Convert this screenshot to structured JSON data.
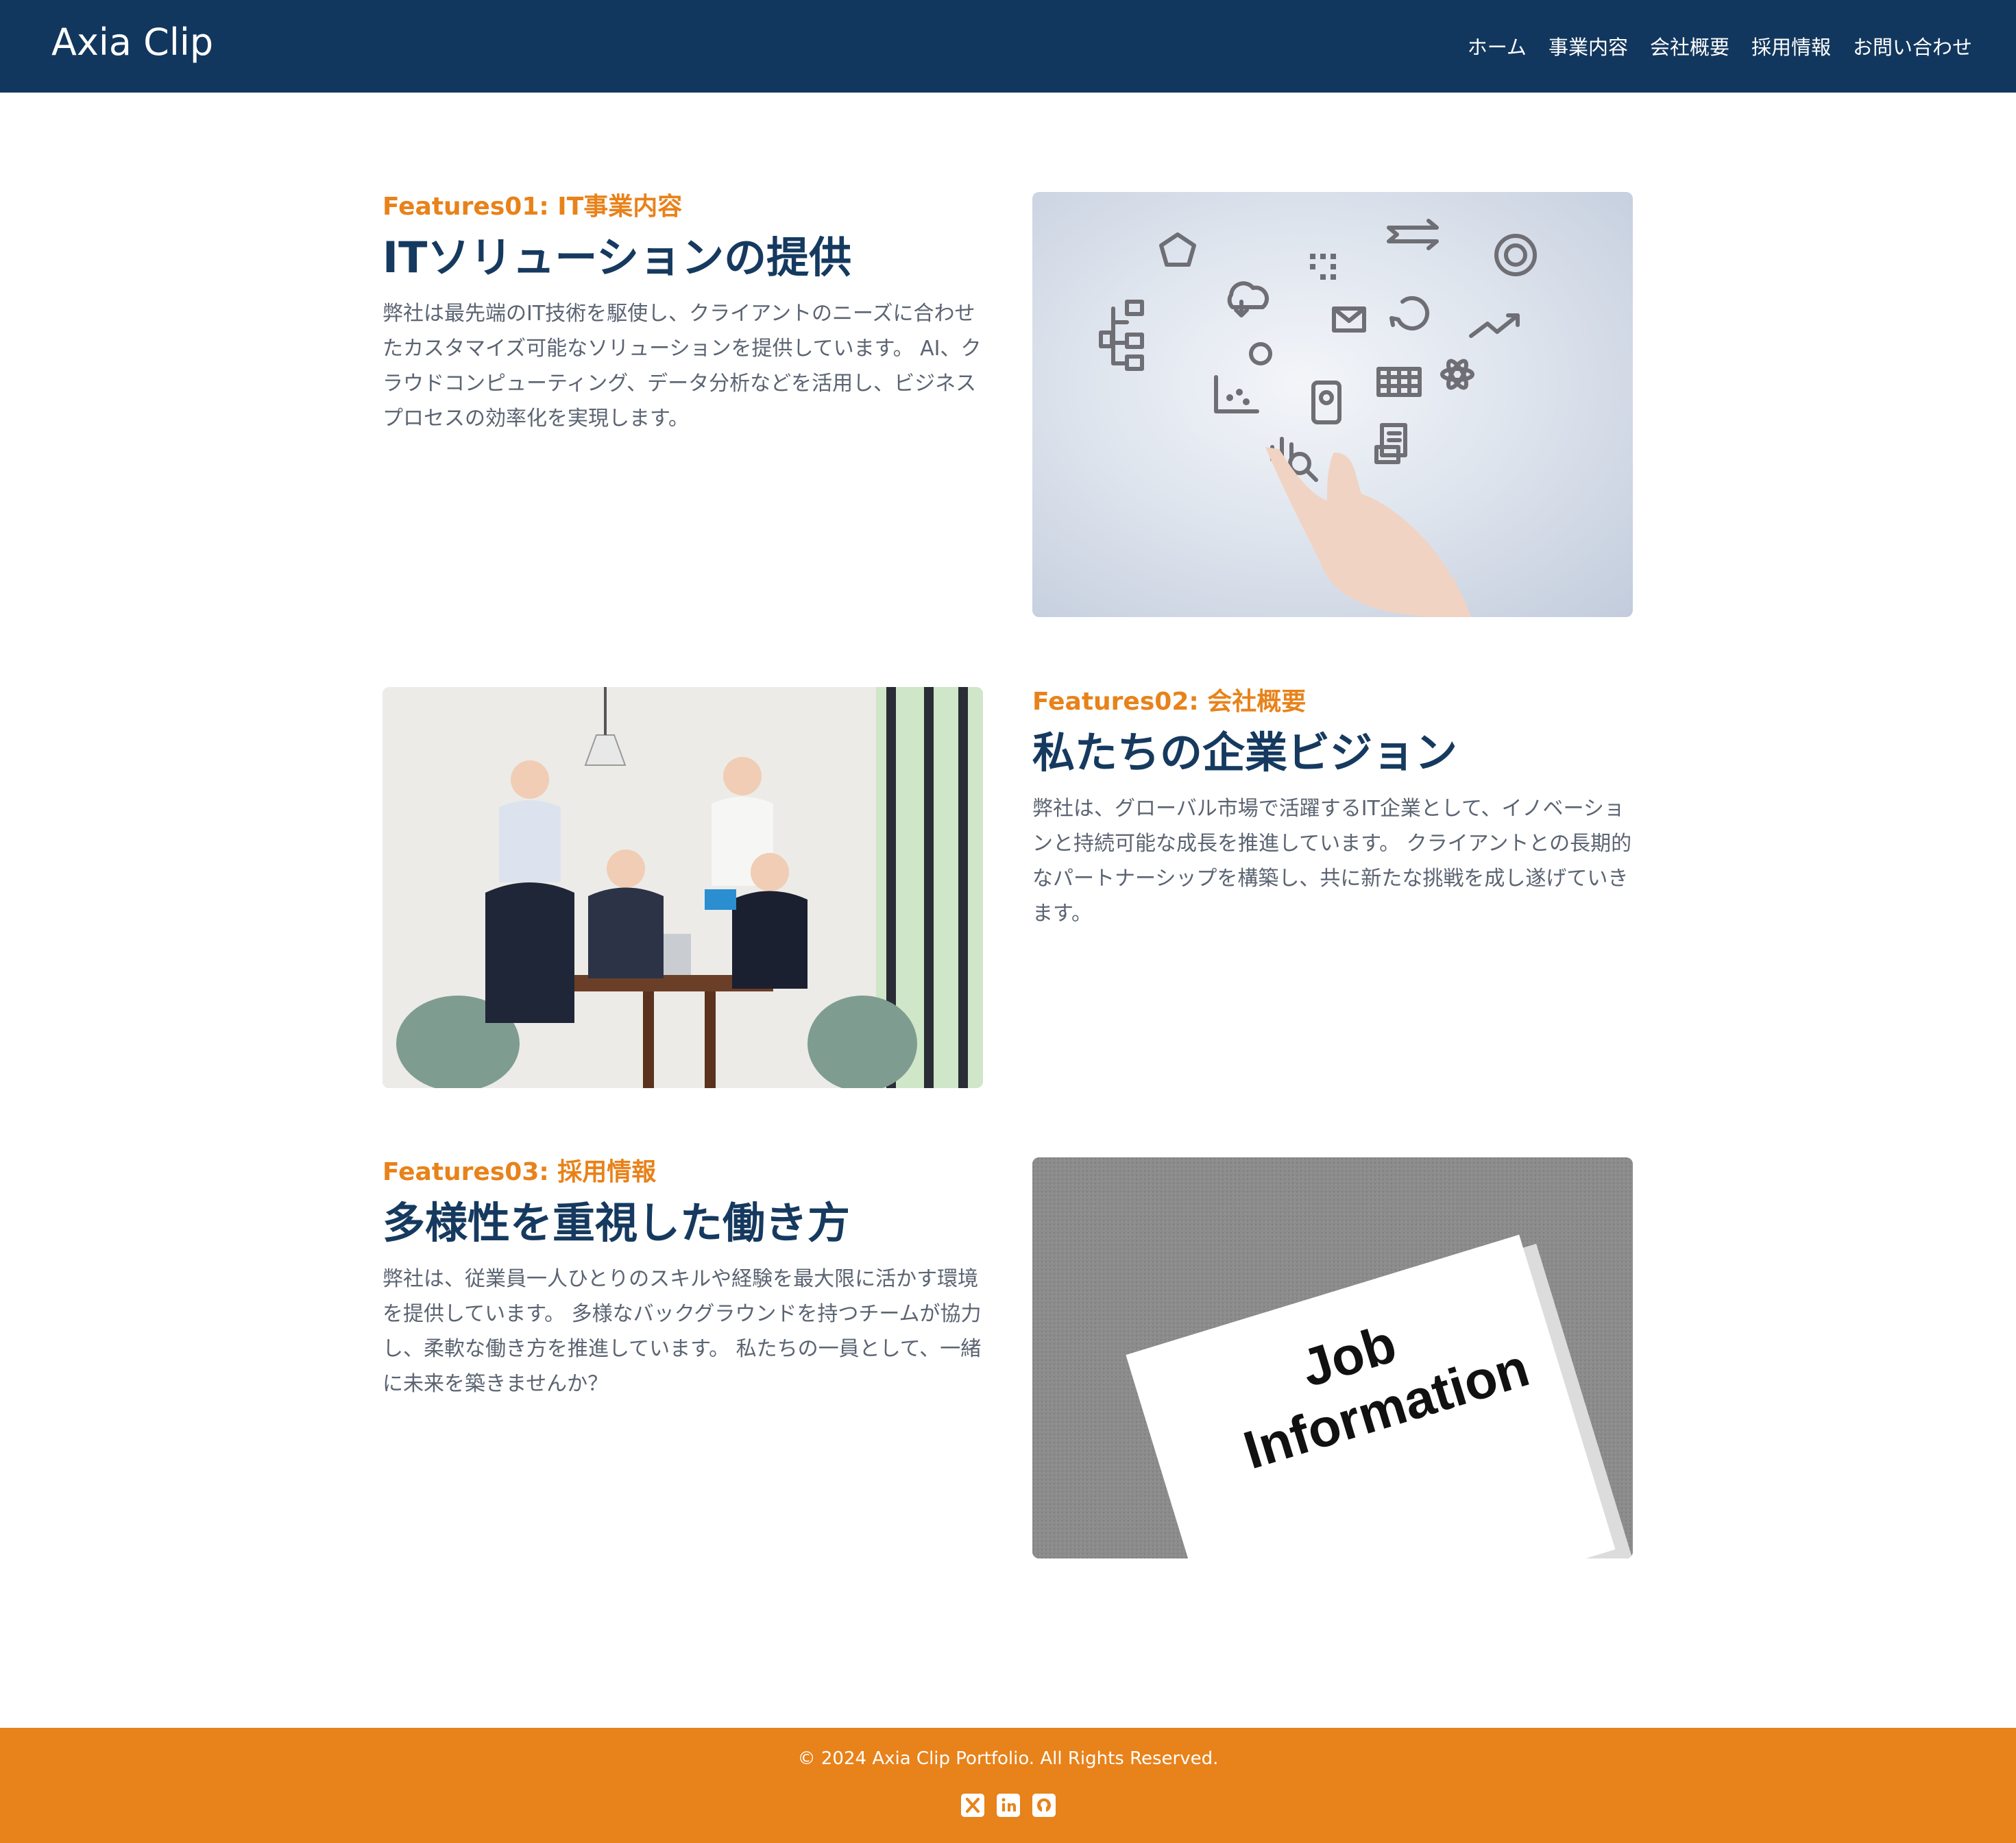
{
  "header": {
    "logo": "Axia Clip",
    "nav": [
      "ホーム",
      "事業内容",
      "会社概要",
      "採用情報",
      "お問い合わせ"
    ]
  },
  "features": [
    {
      "kicker": "Features01: IT事業内容",
      "heading": "ITソリューションの提供",
      "body": "弊社は最先端のIT技術を駆使し、クライアントのニーズに合わせたカスタマイズ可能なソリューションを提供しています。 AI、クラウドコンピューティング、データ分析などを活用し、ビジネスプロセスの効率化を実現します。"
    },
    {
      "kicker": "Features02: 会社概要",
      "heading": "私たちの企業ビジョン",
      "body": "弊社は、グローバル市場で活躍するIT企業として、イノベーションと持続可能な成長を推進しています。 クライアントとの長期的なパートナーシップを構築し、共に新たな挑戦を成し遂げていきます。"
    },
    {
      "kicker": "Features03: 採用情報",
      "heading": "多様性を重視した働き方",
      "body": "弊社は、従業員一人ひとりのスキルや経験を最大限に活かす環境を提供しています。 多様なバックグラウンドを持つチームが協力し、柔軟な働き方を推進しています。 私たちの一員として、一緒に未来を築きませんか？"
    }
  ],
  "images": {
    "job_sign_line1": "Job",
    "job_sign_line2": "Information"
  },
  "footer": {
    "copyright": "© 2024 Axia Clip Portfolio. All Rights Reserved.",
    "social_icons": [
      "x-icon",
      "linkedin-icon",
      "github-icon"
    ]
  },
  "colors": {
    "header_bg": "#12375e",
    "accent": "#e8821a",
    "heading": "#163a5f"
  }
}
